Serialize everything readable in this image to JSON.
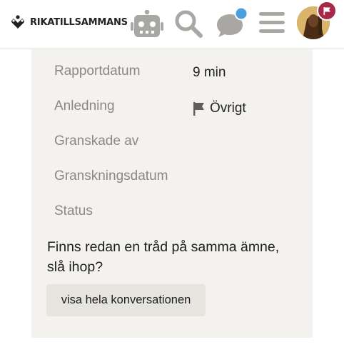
{
  "header": {
    "logo_text": "RIKATILLSAMMANS",
    "icons": [
      "robot-icon",
      "search-icon",
      "chat-icon",
      "hamburger-menu-icon",
      "avatar",
      "flag-icon"
    ],
    "notification_color": "#4aa0dc",
    "flag_badge_color": "#a8284a"
  },
  "report": {
    "rows": [
      {
        "label": "Rapportdatum",
        "value": "9 min"
      },
      {
        "label": "Anledning",
        "value": "Övrigt"
      },
      {
        "label": "Granskade av",
        "value": ""
      },
      {
        "label": "Granskningsdatum",
        "value": ""
      },
      {
        "label": "Status",
        "value": ""
      }
    ],
    "question_line1": "Finns redan en tråd på samma ämne,",
    "question_line2": "slå ihop?",
    "button_label": "visa hela konversationen"
  }
}
